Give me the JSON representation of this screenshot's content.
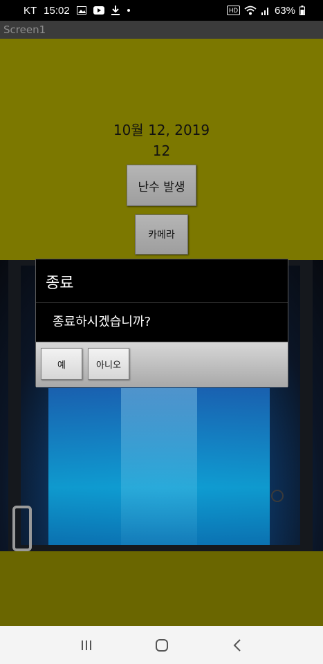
{
  "status_bar": {
    "carrier": "KT",
    "time": "15:02",
    "hd_label": "HD",
    "battery": "63%"
  },
  "app": {
    "screen_title": "Screen1"
  },
  "content": {
    "date_text": "10월 12, 2019",
    "number_text": "12",
    "random_button": "난수 발생",
    "camera_button": "카메라",
    "background_color": "#7c7800"
  },
  "dialog": {
    "title": "종료",
    "message": "종료하시겠습니까?",
    "yes_label": "예",
    "no_label": "아니오"
  },
  "nav_bar": {
    "recent_icon": "recent-apps-icon",
    "home_icon": "home-icon",
    "back_icon": "back-icon"
  }
}
